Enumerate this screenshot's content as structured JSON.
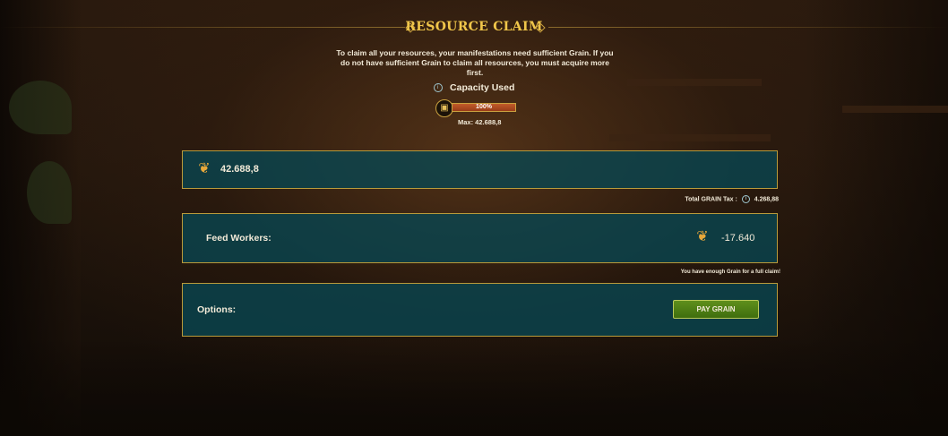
{
  "header": {
    "title": "RESOURCE CLAIM"
  },
  "description": "To claim all your resources, your manifestations need sufficient Grain. If you do not have sufficient Grain to claim all resources, you must acquire more first.",
  "capacity": {
    "label": "Capacity Used",
    "percent_text": "100%",
    "fill_fraction": 1.0,
    "max_text": "Max: 42.688,8"
  },
  "grain_total": {
    "amount": "42.688,8",
    "icon": "grain-icon"
  },
  "tax": {
    "label": "Total GRAIN Tax :",
    "value": "4.268,88"
  },
  "feed_workers": {
    "label": "Feed Workers:",
    "amount": "-17.640",
    "icon": "grain-icon"
  },
  "enough_message": "You have enough Grain for a full claim!",
  "options": {
    "label": "Options:",
    "pay_button": "PAY GRAIN"
  },
  "colors": {
    "accent_gold": "#f0c64a",
    "panel_teal": "#084652",
    "button_green": "#4f7f16",
    "bar_fill": "#c25b2a"
  }
}
